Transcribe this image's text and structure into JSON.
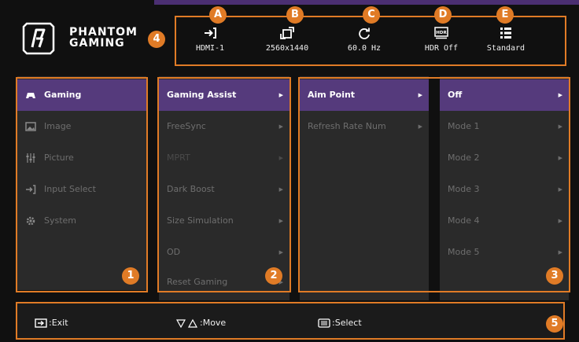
{
  "brand": {
    "name_line1": "PHANTOM",
    "name_line2": "GAMING"
  },
  "status_bar": [
    {
      "badge": "A",
      "icon": "input-icon",
      "value": "HDMI-1"
    },
    {
      "badge": "B",
      "icon": "resolution-icon",
      "value": "2560x1440"
    },
    {
      "badge": "C",
      "icon": "refresh-icon",
      "value": "60.0 Hz"
    },
    {
      "badge": "D",
      "icon": "hdr-icon",
      "value": "HDR Off"
    },
    {
      "badge": "E",
      "icon": "picture-mode-icon",
      "value": "Standard"
    }
  ],
  "section_badges": {
    "brand": "4",
    "main_menu": "1",
    "sub_menu": "2",
    "options": "3",
    "footer": "5"
  },
  "main_menu": [
    {
      "label": "Gaming",
      "icon": "gamepad-icon",
      "selected": true
    },
    {
      "label": "Image",
      "icon": "image-icon"
    },
    {
      "label": "Picture",
      "icon": "sliders-icon"
    },
    {
      "label": "Input Select",
      "icon": "input-icon"
    },
    {
      "label": "System",
      "icon": "gear-icon"
    }
  ],
  "sub_menu": [
    {
      "label": "Gaming Assist",
      "selected": true
    },
    {
      "label": "FreeSync"
    },
    {
      "label": "MPRT",
      "disabled": true
    },
    {
      "label": "Dark Boost"
    },
    {
      "label": "Size Simulation"
    },
    {
      "label": "OD"
    },
    {
      "label": "Reset Gaming"
    }
  ],
  "third_menu": [
    {
      "label": "Aim Point",
      "selected": true
    },
    {
      "label": "Refresh Rate Num"
    }
  ],
  "options": [
    {
      "label": "Off",
      "selected": true
    },
    {
      "label": "Mode 1"
    },
    {
      "label": "Mode 2"
    },
    {
      "label": "Mode 3"
    },
    {
      "label": "Mode 4"
    },
    {
      "label": "Mode 5"
    }
  ],
  "footer": {
    "exit": ":Exit",
    "move": ":Move",
    "select": ":Select"
  },
  "colors": {
    "accent": "#e07b26",
    "selected_bg": "#553a7c",
    "panel_bg": "#2a2a2a",
    "background": "#101010"
  },
  "arrow_glyph": "▶"
}
